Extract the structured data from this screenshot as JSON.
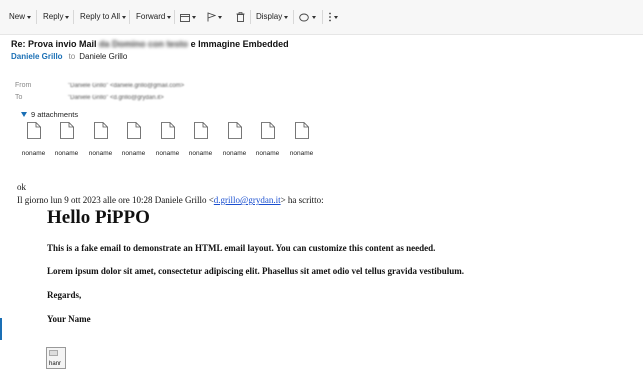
{
  "toolbar": {
    "new": "New",
    "reply": "Reply",
    "reply_all": "Reply to All",
    "forward": "Forward",
    "display": "Display"
  },
  "message": {
    "subject_prefix": "Re: Prova invio Mail",
    "subject_blurred": "da Domino con testo",
    "subject_suffix": "e Immagine Embedded",
    "sender": "Daniele Grillo",
    "to_label": "to",
    "to_name": "Daniele Grillo",
    "from_label": "From",
    "to_field_label": "To",
    "from_value": "\"Daniele Grillo\" <daniele.grillo@gmail.com>",
    "to_value": "\"Daniele Grillo\" <d.grillo@grydan.it>"
  },
  "attachments": {
    "toggle_label": "9 attachments",
    "items": [
      "noname",
      "noname",
      "noname",
      "noname",
      "noname",
      "noname",
      "noname",
      "noname",
      "noname"
    ]
  },
  "body": {
    "reply_text": "ok",
    "quote_prefix": "Il giorno lun 9 ott 2023 alle ore 10:28 Daniele Grillo <",
    "quote_email": "d.grillo@grydan.it",
    "quote_suffix": "> ha scritto:",
    "heading": "Hello PiPPO",
    "para1": "This is a fake email to demonstrate an HTML email layout. You can customize this content as needed.",
    "para2": "Lorem ipsum dolor sit amet, consectetur adipiscing elit. Phasellus sit amet odio vel tellus gravida vestibulum.",
    "regards": "Regards,",
    "your_name": "Your Name",
    "image_label": "hanr"
  },
  "colors": {
    "accent": "#1a6fb5",
    "link": "#1a4fd0"
  },
  "icons": [
    "caret-down-icon",
    "move-folder-icon",
    "flag-icon",
    "trash-icon",
    "tag-icon",
    "more-icon",
    "attachment-toggle-icon",
    "file-icon"
  ]
}
